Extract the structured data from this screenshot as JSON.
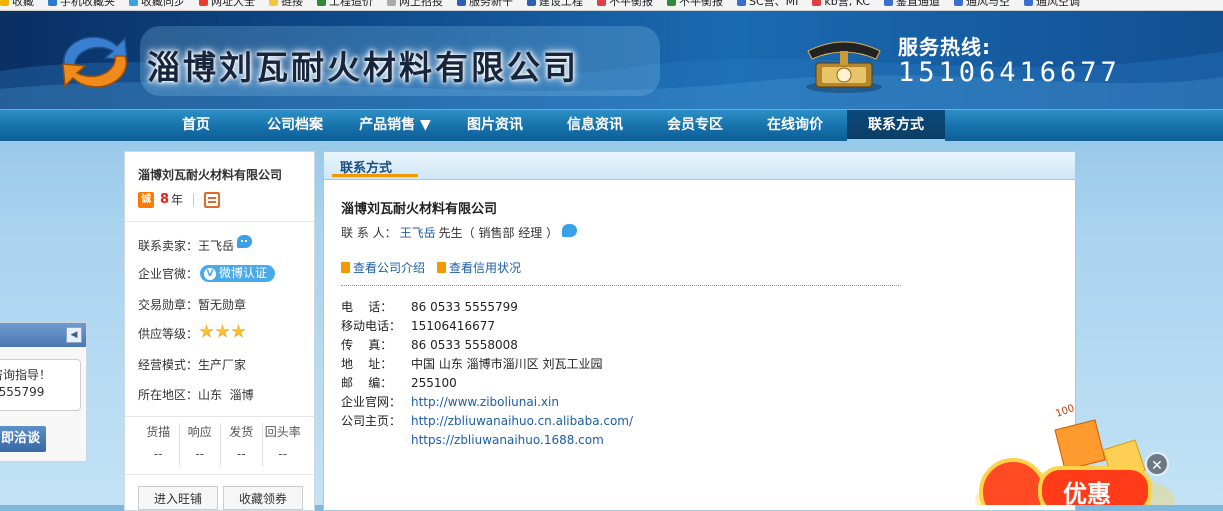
{
  "bookmarks": [
    {
      "label": "收藏",
      "color": "#f0b400"
    },
    {
      "label": "手机收藏夹",
      "color": "#2b7bd1"
    },
    {
      "label": "收藏同步",
      "color": "#3ba3e0"
    },
    {
      "label": "网址大全",
      "color": "#e93c2f"
    },
    {
      "label": "链接",
      "color": "#f5c542"
    },
    {
      "label": "工程造价",
      "color": "#2f8a3a"
    },
    {
      "label": "网上招投",
      "color": "#aaaaaa"
    },
    {
      "label": "服务新干",
      "color": "#2b5fb8"
    },
    {
      "label": "建设工程",
      "color": "#2b5fb8"
    },
    {
      "label": "不平衡报",
      "color": "#e24040"
    },
    {
      "label": "不平衡报",
      "color": "#2f8a3a"
    },
    {
      "label": "SC营、MI",
      "color": "#3b6fcf"
    },
    {
      "label": "kb营, KC",
      "color": "#e24040"
    },
    {
      "label": "鉴直通道",
      "color": "#3b6fcf"
    },
    {
      "label": "通风与空",
      "color": "#3b6fcf"
    },
    {
      "label": "通风空调",
      "color": "#3b6fcf"
    }
  ],
  "header": {
    "company_name": "淄博刘瓦耐火材料有限公司",
    "hotline_label": "服务热线:",
    "hotline_number": "15106416677"
  },
  "nav": {
    "items": [
      "首页",
      "公司档案",
      "产品销售 ▼",
      "图片资讯",
      "信息资讯",
      "会员专区",
      "在线询价",
      "联系方式"
    ],
    "active_index": 7
  },
  "chat_float": {
    "collapse_icon": "◀",
    "line1": "咨询指导！",
    "line2": "5555799",
    "button": "即洽谈"
  },
  "sidebar": {
    "company": "淄博刘瓦耐火材料有限公司",
    "cheng_badge": "诚",
    "years": "8",
    "years_unit": "年",
    "rows": [
      {
        "label": "联系卖家：",
        "value": "王飞岳"
      },
      {
        "label": "企业官微：",
        "value": "微博认证"
      },
      {
        "label": "交易勋章：",
        "value": "暂无勋章"
      },
      {
        "label": "供应等级：",
        "value": ""
      },
      {
        "label": "经营模式：",
        "value": "生产厂家"
      },
      {
        "label": "所在地区：",
        "value": "山东  淄博"
      }
    ],
    "supply_stars": 3,
    "stats": [
      {
        "label": "货描",
        "value": "--"
      },
      {
        "label": "响应",
        "value": "--"
      },
      {
        "label": "发货",
        "value": "--"
      },
      {
        "label": "回头率",
        "value": "--"
      }
    ],
    "btn_shop": "进入旺铺",
    "btn_coupon": "收藏领券"
  },
  "main": {
    "panel_title": "联系方式",
    "company": "淄博刘瓦耐火材料有限公司",
    "contact_label": "联 系 人：",
    "contact_name": "王飞岳",
    "contact_suffix": "先生（ 销售部 经理 ）",
    "link_intro": "查看公司介绍",
    "link_credit": "查看信用状况",
    "info": [
      {
        "k": "电    话：",
        "v": "86 0533 5555799",
        "link": false
      },
      {
        "k": "移动电话：",
        "v": "15106416677",
        "link": false
      },
      {
        "k": "传    真：",
        "v": "86 0533 5558008",
        "link": false
      },
      {
        "k": "地    址：",
        "v": "中国 山东 淄博市淄川区 刘瓦工业园",
        "link": false
      },
      {
        "k": "邮    编：",
        "v": "255100",
        "link": false
      },
      {
        "k": "企业官网：",
        "v": "http://www.ziboliunai.xin",
        "link": true
      },
      {
        "k": "公司主页：",
        "v": "http://zbliuwanaihuo.cn.alibaba.com/",
        "link": true
      },
      {
        "k": "",
        "v": "https://zbliuwanaihuo.1688.com",
        "link": true
      }
    ]
  },
  "promo": {
    "text": "优惠",
    "coupon": "100",
    "close_icon": "✕"
  }
}
